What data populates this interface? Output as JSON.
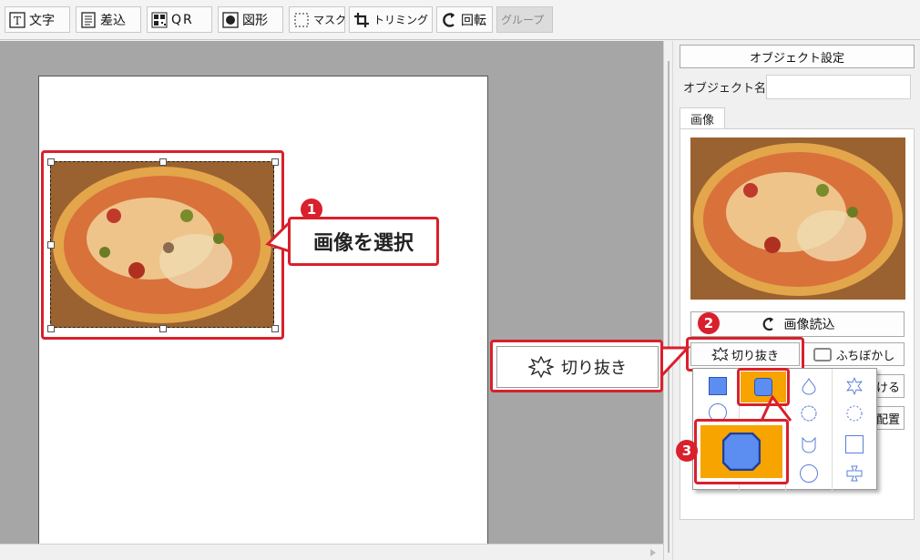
{
  "toolbar": {
    "items": [
      {
        "label": "文字",
        "icon": "text-frame-icon"
      },
      {
        "label": "差込",
        "icon": "merge-document-icon"
      },
      {
        "label": "QR",
        "icon": "qr-code-icon"
      },
      {
        "label": "図形",
        "icon": "shape-icon"
      },
      {
        "label": "マスク",
        "icon": "mask-icon"
      },
      {
        "label": "トリミング",
        "icon": "crop-icon"
      },
      {
        "label": "回転",
        "icon": "rotate-icon"
      },
      {
        "label": "グループ",
        "icon": ""
      }
    ]
  },
  "panel": {
    "title": "オブジェクト設定",
    "object_name_label": "オブジェクト名",
    "object_name_value": "",
    "tab_image": "画像",
    "load_image_label": "画像読込",
    "cutout_label": "切り抜き",
    "blur_label": "ふちぼかし",
    "partial_label_1": "ける",
    "partial_label_2": "配置"
  },
  "annotations": {
    "step1_number": "1",
    "step1_text": "画像を選択",
    "step2_number": "2",
    "cutout_callout_label": "切り抜き",
    "step3_number": "3"
  },
  "colors": {
    "accent_red": "#d9202c",
    "selected_orange": "#f7a300",
    "shape_blue": "#5b8ef0",
    "canvas_gray": "#a6a6a6"
  }
}
